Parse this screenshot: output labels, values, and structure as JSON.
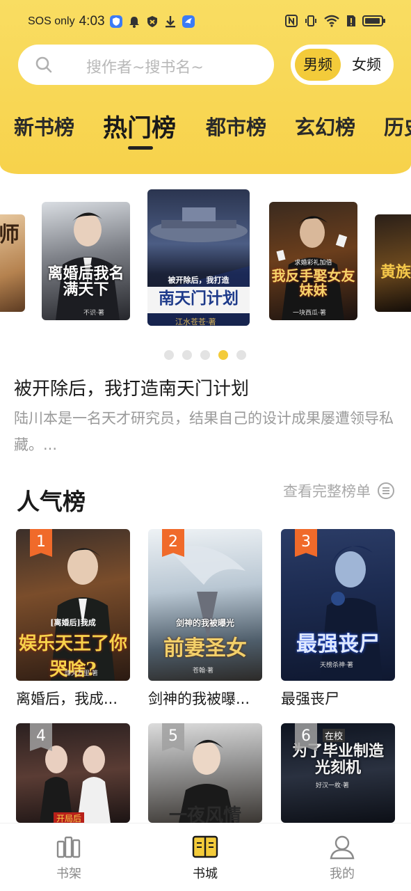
{
  "status_bar": {
    "sos": "SOS only",
    "time": "4:03"
  },
  "search": {
    "placeholder": "搜作者~搜书名~"
  },
  "gender": {
    "male": "男频",
    "female": "女频",
    "selected": "男频"
  },
  "tabs": [
    {
      "label": "新书榜"
    },
    {
      "label": "热门榜"
    },
    {
      "label": "都市榜"
    },
    {
      "label": "玄幻榜"
    },
    {
      "label": "历史榜"
    }
  ],
  "carousel": {
    "covers": [
      {
        "art_text": "师"
      },
      {
        "art_text": "离婚后我名满天下",
        "author": "不识·著"
      },
      {
        "art_text": "南天门计划",
        "subtitle": "被开除后，我打造",
        "author": "江水苍苍·著"
      },
      {
        "art_text": "我反手娶女友妹妹",
        "subtitle": "求婚彩礼加倍",
        "author": "一块西瓜·著"
      },
      {
        "art_text": "黄族"
      }
    ],
    "featured": {
      "title": "被开除后，我打造南天门计划",
      "description": "陆川本是一名天才研究员，结果自己的设计成果屡遭领导私藏。..."
    },
    "dots": 5,
    "active_dot": 4
  },
  "section": {
    "title": "人气榜",
    "more_label": "查看完整榜单"
  },
  "books": [
    {
      "rank": "1",
      "name": "离婚后，我成...",
      "art_text": "娱乐天王了你哭啥?",
      "art_sub": "[离婚后]我成",
      "author": "烽火万里·著"
    },
    {
      "rank": "2",
      "name": "剑神的我被曝...",
      "art_text": "前妻圣女",
      "art_sub": "剑神的我被曝光",
      "author": "苍翰·著"
    },
    {
      "rank": "3",
      "name": "最强丧尸",
      "art_text": "最强丧尸",
      "author": "天榜杀神·著"
    },
    {
      "rank": "4",
      "name": "",
      "art_text": "开局后"
    },
    {
      "rank": "5",
      "name": "",
      "art_text": "一夜风情"
    },
    {
      "rank": "6",
      "name": "",
      "art_text": "为了毕业制造光刻机",
      "art_sub": "在校",
      "author": "好汉一枚·著"
    }
  ],
  "bottom_nav": [
    {
      "label": "书架",
      "icon": "bookshelf-icon"
    },
    {
      "label": "书城",
      "icon": "open-book-icon"
    },
    {
      "label": "我的",
      "icon": "profile-icon"
    }
  ],
  "colors": {
    "header_yellow": "#f7d24b",
    "accent": "#f3cb3a",
    "rank_orange": "#f06a2a",
    "muted_text": "#9a9a9a"
  }
}
